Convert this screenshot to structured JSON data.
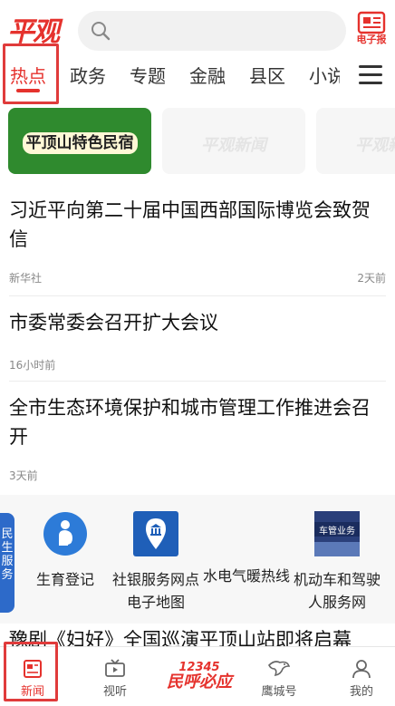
{
  "header": {
    "logo": "平观",
    "epaper_label": "电子报"
  },
  "tabs": [
    "热点",
    "政务",
    "专题",
    "金融",
    "县区",
    "小说"
  ],
  "banners": {
    "first": "平顶山特色民宿",
    "ghost1": "平观新闻",
    "ghost2": "平观新闻"
  },
  "news": [
    {
      "title": "习近平向第二十届中国西部国际博览会致贺信",
      "source": "新华社",
      "time": "2天前"
    },
    {
      "title": "市委常委会召开扩大会议",
      "source": "",
      "time": "16小时前"
    },
    {
      "title": "全市生态环境保护和城市管理工作推进会召开",
      "source": "",
      "time": "3天前"
    }
  ],
  "services": {
    "side_tag": "民生服务",
    "items": [
      {
        "name": "生育登记",
        "icon": "pregnant-woman-icon"
      },
      {
        "name": "社银服务网点电子地图",
        "icon": "bank-map-pin-icon"
      },
      {
        "name": "水电气暖热线",
        "icon": "utility-hotline-icon"
      },
      {
        "name": "机动车和驾驶人服务网",
        "icon": "vehicle-service-icon"
      }
    ],
    "vehicle_sign": "车管业务"
  },
  "peek_headline": "豫剧《妇好》全国巡演平顶山站即将启幕",
  "bottom_nav": {
    "news": "新闻",
    "video": "视听",
    "brand_num": "12345",
    "brand_text": "民呼必应",
    "city": "鹰城号",
    "mine": "我的"
  },
  "colors": {
    "accent": "#e5322d",
    "highlight_box": "#e03b3b",
    "service_tag": "#2d6ac9"
  }
}
